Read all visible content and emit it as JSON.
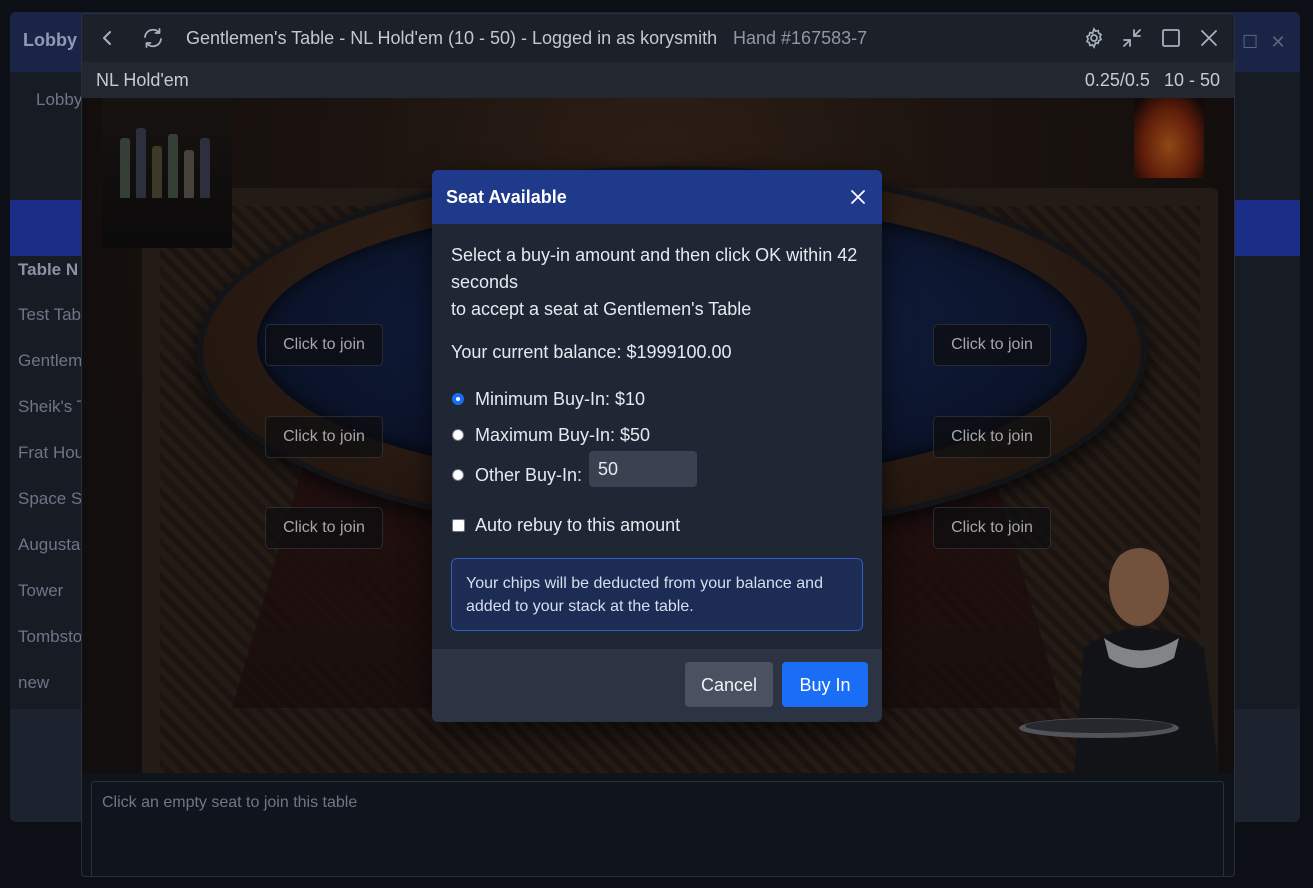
{
  "lobby": {
    "title": "Lobby",
    "tab": "Lobby",
    "column_header": "Table N",
    "rows": [
      "Test Tab",
      "Gentlem",
      "Sheik's T",
      "Frat Hou",
      "Space S",
      "Augusta",
      "Tower",
      "Tombsto",
      "new"
    ]
  },
  "window": {
    "title": "Gentlemen's Table - NL Hold'em (10 - 50) - Logged in as korysmith",
    "hand": "Hand #167583-7",
    "icons": [
      "back-icon",
      "refresh-icon",
      "gear-icon",
      "minimize-icon",
      "maximize-icon",
      "close-icon"
    ]
  },
  "subbar": {
    "game": "NL Hold'em",
    "blinds": "0.25/0.5",
    "buyin_range": "10 - 50"
  },
  "seats": [
    "Click to join",
    "Click to join",
    "Click to join",
    "Click to join",
    "Click to join",
    "Click to join"
  ],
  "chat": {
    "placeholder": "Click an empty seat to join this table"
  },
  "dialog": {
    "title": "Seat Available",
    "instruction_line1": "Select a buy-in amount and then click OK within 42 seconds",
    "instruction_line2": "to accept a seat at Gentlemen's Table",
    "balance": "Your current balance: $1999100.00",
    "options": {
      "min": "Minimum Buy-In: $10",
      "max": "Maximum Buy-In: $50",
      "other": "Other Buy-In:",
      "selected": "min"
    },
    "other_value": "50",
    "auto_rebuy": "Auto rebuy to this amount",
    "auto_rebuy_checked": false,
    "info": "Your chips will be deducted from your balance and added to your stack at the table.",
    "cancel": "Cancel",
    "buyin": "Buy In"
  },
  "colors": {
    "accent": "#1a6df5",
    "dialog_header": "#1f3a8a",
    "info_border": "#2f5ec4"
  }
}
